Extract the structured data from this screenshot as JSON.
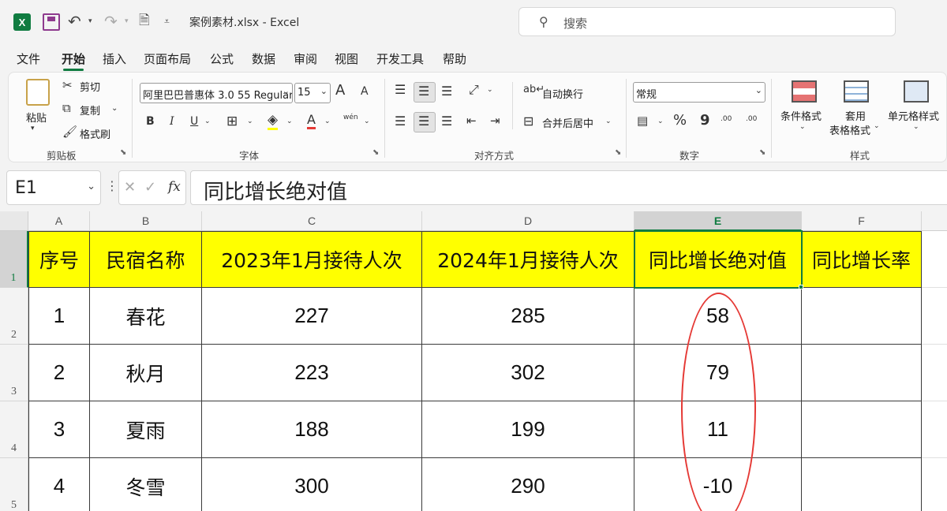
{
  "window": {
    "title": "案例素材.xlsx  -  Excel",
    "app_icon": "X",
    "search_placeholder": "搜索"
  },
  "menu_tabs": [
    "文件",
    "开始",
    "插入",
    "页面布局",
    "公式",
    "数据",
    "审阅",
    "视图",
    "开发工具",
    "帮助"
  ],
  "active_tab": "开始",
  "ribbon": {
    "clipboard": {
      "label": "剪贴板",
      "paste": "粘贴",
      "cut": "剪切",
      "copy": "复制",
      "format_painter": "格式刷"
    },
    "font": {
      "label": "字体",
      "font_name": "阿里巴巴普惠体 3.0 55 Regular",
      "font_size": "15",
      "bold": "B",
      "italic": "I",
      "underline": "U",
      "grow": "A",
      "shrink": "A",
      "phonetic": "wén"
    },
    "alignment": {
      "label": "对齐方式",
      "wrap_text": "自动换行",
      "merge_center": "合并后居中"
    },
    "number": {
      "label": "数字",
      "format": "常规",
      "percent": "%",
      "comma": "9",
      "inc_decimal": ".00",
      "dec_decimal": ".00"
    },
    "styles": {
      "label": "样式",
      "conditional": "条件格式",
      "table_line1": "套用",
      "table_line2": "表格格式",
      "cell_styles": "单元格样式"
    }
  },
  "formula_bar": {
    "name_box": "E1",
    "fx": "fx",
    "value": "同比增长绝对值"
  },
  "sheet": {
    "columns": [
      "A",
      "B",
      "C",
      "D",
      "E",
      "F"
    ],
    "rows": [
      "1",
      "2",
      "3",
      "4",
      "5"
    ],
    "headers": [
      "序号",
      "民宿名称",
      "2023年1月接待人次",
      "2024年1月接待人次",
      "同比增长绝对值",
      "同比增长率"
    ],
    "data": [
      [
        "1",
        "春花",
        "227",
        "285",
        "58",
        ""
      ],
      [
        "2",
        "秋月",
        "223",
        "302",
        "79",
        ""
      ],
      [
        "3",
        "夏雨",
        "188",
        "199",
        "11",
        ""
      ],
      [
        "4",
        "冬雪",
        "300",
        "290",
        "-10",
        ""
      ]
    ],
    "selected_cell": "E1",
    "header_fill": "#ffff00",
    "annotation_color": "#e53935",
    "accent": "#107c41"
  }
}
